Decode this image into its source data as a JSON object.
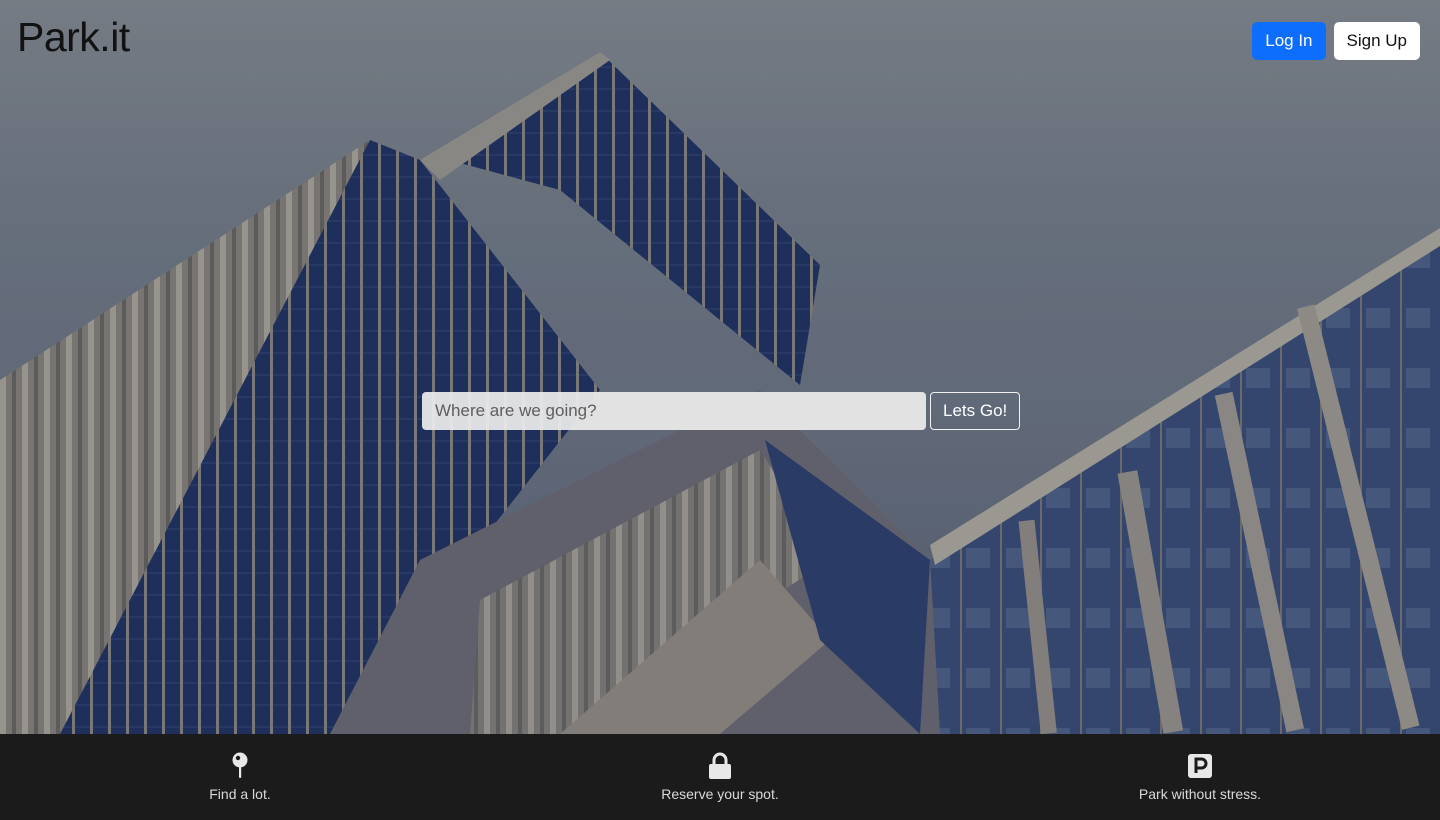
{
  "header": {
    "logo": "Park.it",
    "login_label": "Log In",
    "signup_label": "Sign Up"
  },
  "search": {
    "placeholder": "Where are we going?",
    "value": "",
    "submit_label": "Lets Go!"
  },
  "features": [
    {
      "icon": "map-pin-icon",
      "label": "Find a lot."
    },
    {
      "icon": "lock-icon",
      "label": "Reserve your spot."
    },
    {
      "icon": "parking-icon",
      "label": "Park without stress."
    }
  ],
  "colors": {
    "primary": "#0d6efd",
    "footer_bg": "#1b1b1b",
    "footer_text": "#d9d9d9"
  }
}
